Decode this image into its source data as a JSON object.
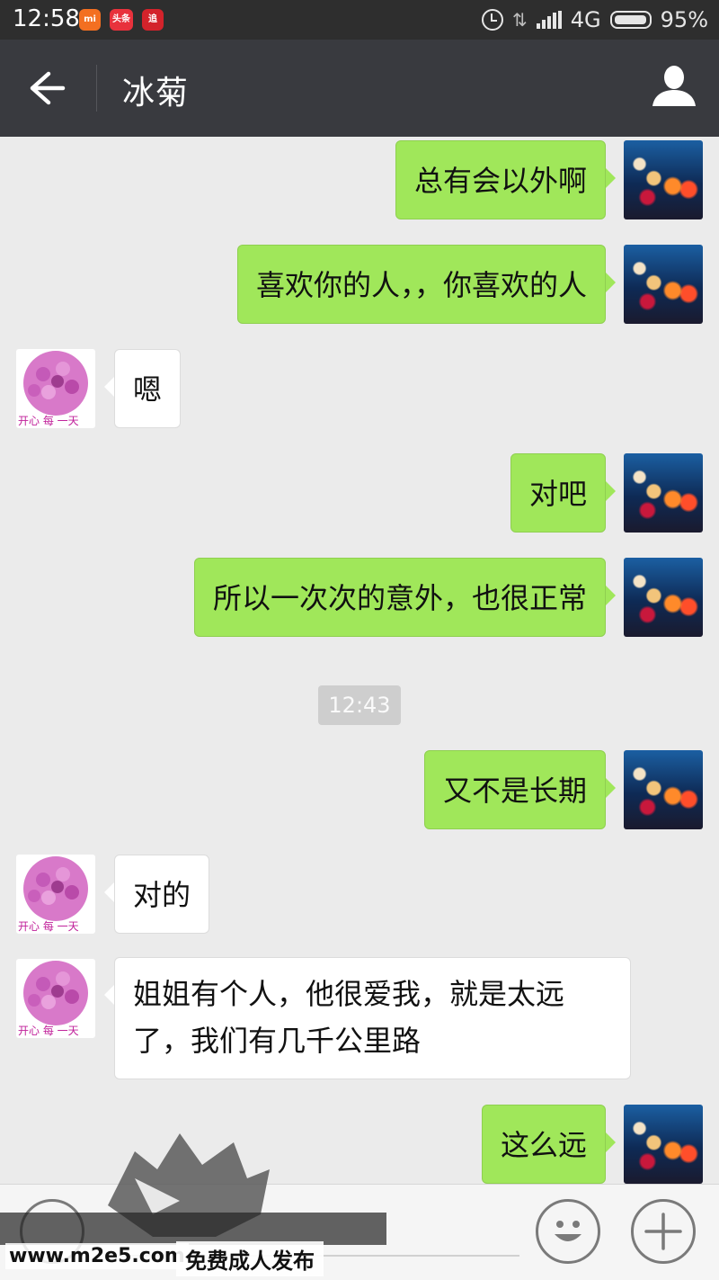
{
  "status_bar": {
    "time": "12:58",
    "network": "4G",
    "battery": "95%",
    "notification_icons": [
      "mi-icon",
      "toutiao-icon",
      "zhui-icon"
    ],
    "notif_labels": {
      "mi": "mi",
      "toutiao": "头条",
      "zhui": "追"
    }
  },
  "header": {
    "title": "冰菊"
  },
  "messages": [
    {
      "from": "me",
      "text": "总有会以外啊"
    },
    {
      "from": "me",
      "text": "喜欢你的人，，你喜欢的人"
    },
    {
      "from": "friend",
      "text": "嗯",
      "avatar_caption": "开心 每 一天"
    },
    {
      "from": "me",
      "text": "对吧"
    },
    {
      "from": "me",
      "text": "所以一次次的意外，也很正常"
    },
    {
      "from": "me",
      "text": "又不是长期"
    },
    {
      "from": "friend",
      "text": "对的",
      "avatar_caption": "开心 每 一天"
    },
    {
      "from": "friend",
      "text": "姐姐有个人，他很爱我，就是太远了，我们有几千公里路",
      "avatar_caption": "开心 每 一天"
    },
    {
      "from": "me",
      "text": "这么远"
    }
  ],
  "timestamp": "12:43",
  "watermark": {
    "url": "www.m2e5.com",
    "tagline": "免费成人发布"
  },
  "colors": {
    "outgoing_bubble": "#a0e75a",
    "incoming_bubble": "#ffffff",
    "chat_background": "#ebebeb",
    "title_bar": "#393a3f"
  }
}
